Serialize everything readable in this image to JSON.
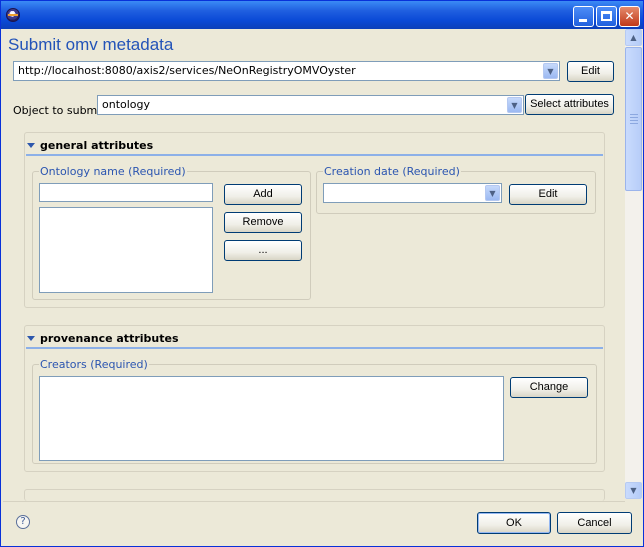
{
  "window": {
    "title": ""
  },
  "header": {
    "title": "Submit omv metadata"
  },
  "registry": {
    "url": "http://localhost:8080/axis2/services/NeOnRegistryOMVOyster",
    "edit_label": "Edit"
  },
  "object": {
    "label": "Object to submit",
    "value": "ontology",
    "select_label": "Select attributes"
  },
  "general": {
    "title": "general attributes",
    "ontology_name_label": "Ontology name (Required)",
    "ontology_name_value": "",
    "add_label": "Add",
    "remove_label": "Remove",
    "more_label": "...",
    "creation_date_label": "Creation date (Required)",
    "creation_date_value": "",
    "creation_edit_label": "Edit"
  },
  "provenance": {
    "title": "provenance attributes",
    "creators_label": "Creators (Required)",
    "change_label": "Change"
  },
  "footer": {
    "ok_label": "OK",
    "cancel_label": "Cancel",
    "help_icon": "?"
  },
  "icons": [
    "eclipse-icon",
    "minimize-icon",
    "maximize-icon",
    "close-icon",
    "chevron-down-icon",
    "help-icon"
  ]
}
